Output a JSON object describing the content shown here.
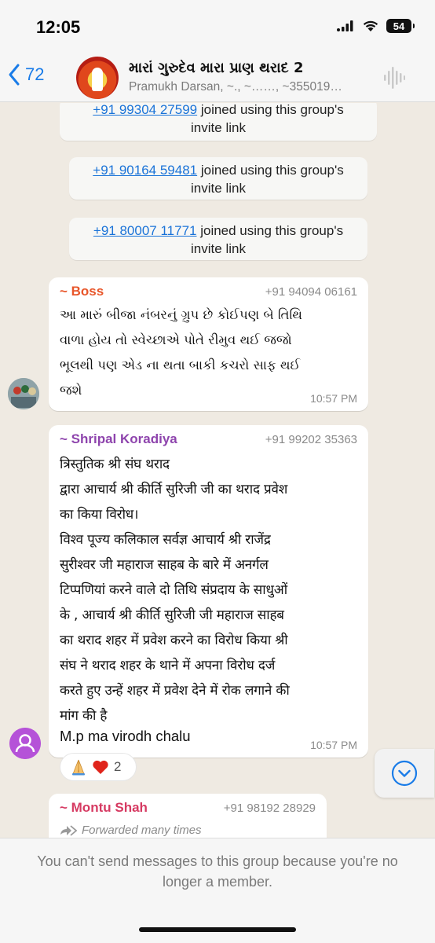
{
  "status_bar": {
    "time": "12:05",
    "battery": "54"
  },
  "header": {
    "back_count": "72",
    "title": "મારાં ગુરુદેવ મારા પ્રાણ થરાદ 2",
    "subtitle": "Pramukh Darsan, ~., ~……, ~355019…"
  },
  "system_messages": [
    {
      "phone": "+91 99304 27599",
      "text_after": " joined using this group's",
      "line2": "invite link"
    },
    {
      "phone": "+91 90164 59481",
      "text_after": " joined using this group's",
      "line2": "invite link"
    },
    {
      "phone": "+91 80007 11771",
      "text_after": " joined using this group's",
      "line2": "invite link"
    }
  ],
  "messages": [
    {
      "sender": "~ Boss",
      "sender_color": "#e8562a",
      "phone": "+91 94094 06161",
      "text": "આ મારું બીજા નંબરનું ગ્રુપ છે કોઈપણ બે તિથિ\nવાળા હોય તો સ્વેચ્છાએ પોતે રીમુવ થઈ જજો\nભૂલથી પણ એડ ના થતા બાકી કચરો સાફ થઈ\nજશે",
      "time": "10:57 PM"
    },
    {
      "sender": "~ Shripal Koradiya",
      "sender_color": "#8e44ad",
      "phone": "+91 99202 35363",
      "text": "त्रिस्तुतिक श्री संघ थराद\n द्वारा आचार्य श्री कीर्ति सुरिजी जी का थराद प्रवेश\nका किया विरोध।\nविश्व पूज्य कलिकाल सर्वज्ञ आचार्य श्री राजेंद्र\nसुरीश्वर जी महाराज साहब  के बारे में अनर्गल\nटिप्पणियां करने वाले दो तिथि संप्रदाय के साधुओं\nके , आचार्य श्री कीर्ति सुरिजी जी महाराज साहब\nका थराद शहर में प्रवेश करने का विरोध किया श्री\nसंघ ने थराद शहर के थाने में अपना विरोध दर्ज\nकरते हुए उन्हें शहर में प्रवेश देने में रोक लगाने की\nमांग की है",
      "extra_line": "M.p ma virodh chalu",
      "time": "10:57 PM",
      "reaction_count": "2"
    },
    {
      "sender": "~ Montu Shah",
      "sender_color": "#d63a62",
      "phone": "+91 98192 28929",
      "forwarded": "Forwarded many times"
    }
  ],
  "footer": {
    "line1": "You can't send messages to this group because you're no",
    "line2": "longer a member."
  },
  "colors": {
    "accent": "#1a7ce8",
    "link": "#1a73d8",
    "chat_bg": "#efeae2"
  }
}
